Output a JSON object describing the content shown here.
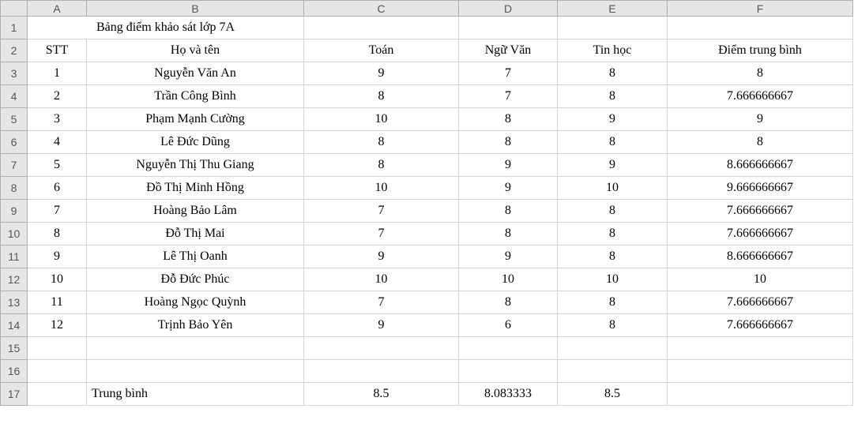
{
  "columns": [
    "A",
    "B",
    "C",
    "D",
    "E",
    "F"
  ],
  "rowNums": [
    1,
    2,
    3,
    4,
    5,
    6,
    7,
    8,
    9,
    10,
    11,
    12,
    13,
    14,
    15,
    16,
    17
  ],
  "title": "Bảng điểm khảo sát lớp 7A",
  "headers": {
    "stt": "STT",
    "hoten": "Họ và tên",
    "toan": "Toán",
    "nguvan": "Ngữ Văn",
    "tinhoc": "Tin học",
    "diemtb": "Điểm trung bình"
  },
  "rows": [
    {
      "stt": "1",
      "name": "Nguyễn Văn An",
      "toan": "9",
      "van": "7",
      "tin": "8",
      "tb": "8"
    },
    {
      "stt": "2",
      "name": "Trần Công Bình",
      "toan": "8",
      "van": "7",
      "tin": "8",
      "tb": "7.666666667"
    },
    {
      "stt": "3",
      "name": "Phạm Mạnh Cường",
      "toan": "10",
      "van": "8",
      "tin": "9",
      "tb": "9"
    },
    {
      "stt": "4",
      "name": "Lê Đức Dũng",
      "toan": "8",
      "van": "8",
      "tin": "8",
      "tb": "8"
    },
    {
      "stt": "5",
      "name": "Nguyễn Thị Thu Giang",
      "toan": "8",
      "van": "9",
      "tin": "9",
      "tb": "8.666666667"
    },
    {
      "stt": "6",
      "name": "Đồ Thị Minh Hồng",
      "toan": "10",
      "van": "9",
      "tin": "10",
      "tb": "9.666666667"
    },
    {
      "stt": "7",
      "name": "Hoàng Bảo Lâm",
      "toan": "7",
      "van": "8",
      "tin": "8",
      "tb": "7.666666667"
    },
    {
      "stt": "8",
      "name": "Đỗ Thị Mai",
      "toan": "7",
      "van": "8",
      "tin": "8",
      "tb": "7.666666667"
    },
    {
      "stt": "9",
      "name": "Lê Thị Oanh",
      "toan": "9",
      "van": "9",
      "tin": "8",
      "tb": "8.666666667"
    },
    {
      "stt": "10",
      "name": "Đỗ Đức Phúc",
      "toan": "10",
      "van": "10",
      "tin": "10",
      "tb": "10"
    },
    {
      "stt": "11",
      "name": "Hoàng Ngọc Quỳnh",
      "toan": "7",
      "van": "8",
      "tin": "8",
      "tb": "7.666666667"
    },
    {
      "stt": "12",
      "name": "Trịnh Bảo Yên",
      "toan": "9",
      "van": "6",
      "tin": "8",
      "tb": "7.666666667"
    }
  ],
  "footer": {
    "label": "Trung bình",
    "toan": "8.5",
    "van": "8.083333",
    "tin": "8.5",
    "tb": ""
  }
}
